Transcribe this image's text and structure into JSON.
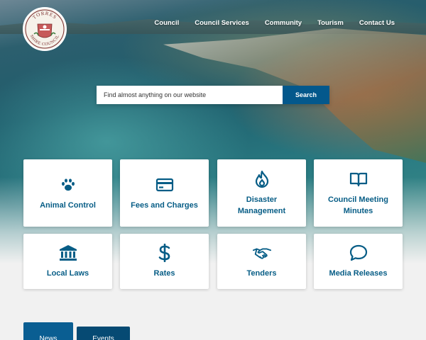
{
  "header": {
    "logo_icon": "torres-shire-council-seal",
    "logo_text": "TORRES SHIRE COUNCIL"
  },
  "nav": {
    "items": [
      "Council",
      "Council Services",
      "Community",
      "Tourism",
      "Contact Us"
    ]
  },
  "search": {
    "placeholder": "Find almost anything on our website",
    "button_label": "Search"
  },
  "tiles": [
    {
      "label": "Animal Control",
      "icon": "paw-icon"
    },
    {
      "label": "Fees and Charges",
      "icon": "credit-card-icon"
    },
    {
      "label": "Disaster Management",
      "icon": "flame-icon"
    },
    {
      "label": "Council Meeting Minutes",
      "icon": "book-open-icon"
    },
    {
      "label": "Local Laws",
      "icon": "courthouse-icon"
    },
    {
      "label": "Rates",
      "icon": "dollar-icon"
    },
    {
      "label": "Tenders",
      "icon": "handshake-icon"
    },
    {
      "label": "Media Releases",
      "icon": "speech-bubble-icon"
    }
  ],
  "tabs": [
    {
      "label": "News",
      "active": true
    },
    {
      "label": "Events",
      "active": false
    }
  ],
  "colors": {
    "accent": "#075d86",
    "search_button": "#03588c",
    "tab_active": "#0a5e92",
    "tab_inactive": "#064a73"
  }
}
